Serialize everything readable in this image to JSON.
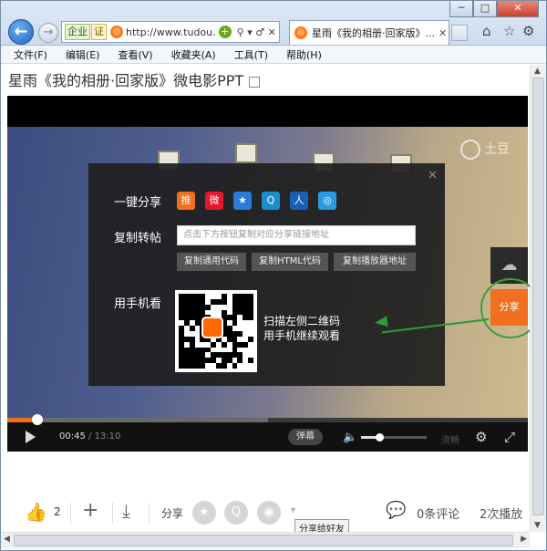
{
  "window": {
    "minimize": "─",
    "maximize": "□",
    "close": "✕"
  },
  "address": {
    "tag_a": "企业",
    "tag_b": "证",
    "url": "http://www.tudou.",
    "controls": "⚲ ▾ ♂ ✕"
  },
  "tab": {
    "title": "星雨《我的相册·回家版》...",
    "close": "✕"
  },
  "menu": [
    "文件(F)",
    "编辑(E)",
    "查看(V)",
    "收藏夹(A)",
    "工具(T)",
    "帮助(H)"
  ],
  "page": {
    "title": "星雨《我的相册·回家版》微电影PPT"
  },
  "share": {
    "one_click_label": "一键分享",
    "icons": [
      {
        "name": "tuijian-icon",
        "glyph": "推",
        "color": "#f07020"
      },
      {
        "name": "weibo-icon",
        "glyph": "微",
        "color": "#e6162d"
      },
      {
        "name": "star-icon",
        "glyph": "★",
        "color": "#2a7bd8"
      },
      {
        "name": "qq-icon",
        "glyph": "Q",
        "color": "#1a8fd0"
      },
      {
        "name": "renren-icon",
        "glyph": "人",
        "color": "#1a5fb4"
      },
      {
        "name": "qzone-icon",
        "glyph": "◎",
        "color": "#2a9be0"
      }
    ],
    "copy_label": "复制转帖",
    "url_placeholder": "点击下方按钮复制对应分享链接地址",
    "copy_buttons": [
      "复制通用代码",
      "复制HTML代码",
      "复制播放器地址"
    ],
    "mobile_label": "用手机看",
    "scan_line1": "扫描左侧二维码",
    "scan_line2": "用手机继续观看",
    "close": "✕"
  },
  "watermark": "土豆",
  "side": {
    "cloud": "☁",
    "share": "分享"
  },
  "player": {
    "current": "00:45",
    "sep": " / ",
    "total": "13:10",
    "progress": 0.057,
    "buffered": 0.5,
    "danmu": "弹幕",
    "quality": "流畅",
    "volume": 0.28
  },
  "bottom": {
    "like_count": "2",
    "share_label": "分享",
    "comments": "0条评论",
    "plays": "2次播放"
  },
  "tooltip": "分享给好友"
}
